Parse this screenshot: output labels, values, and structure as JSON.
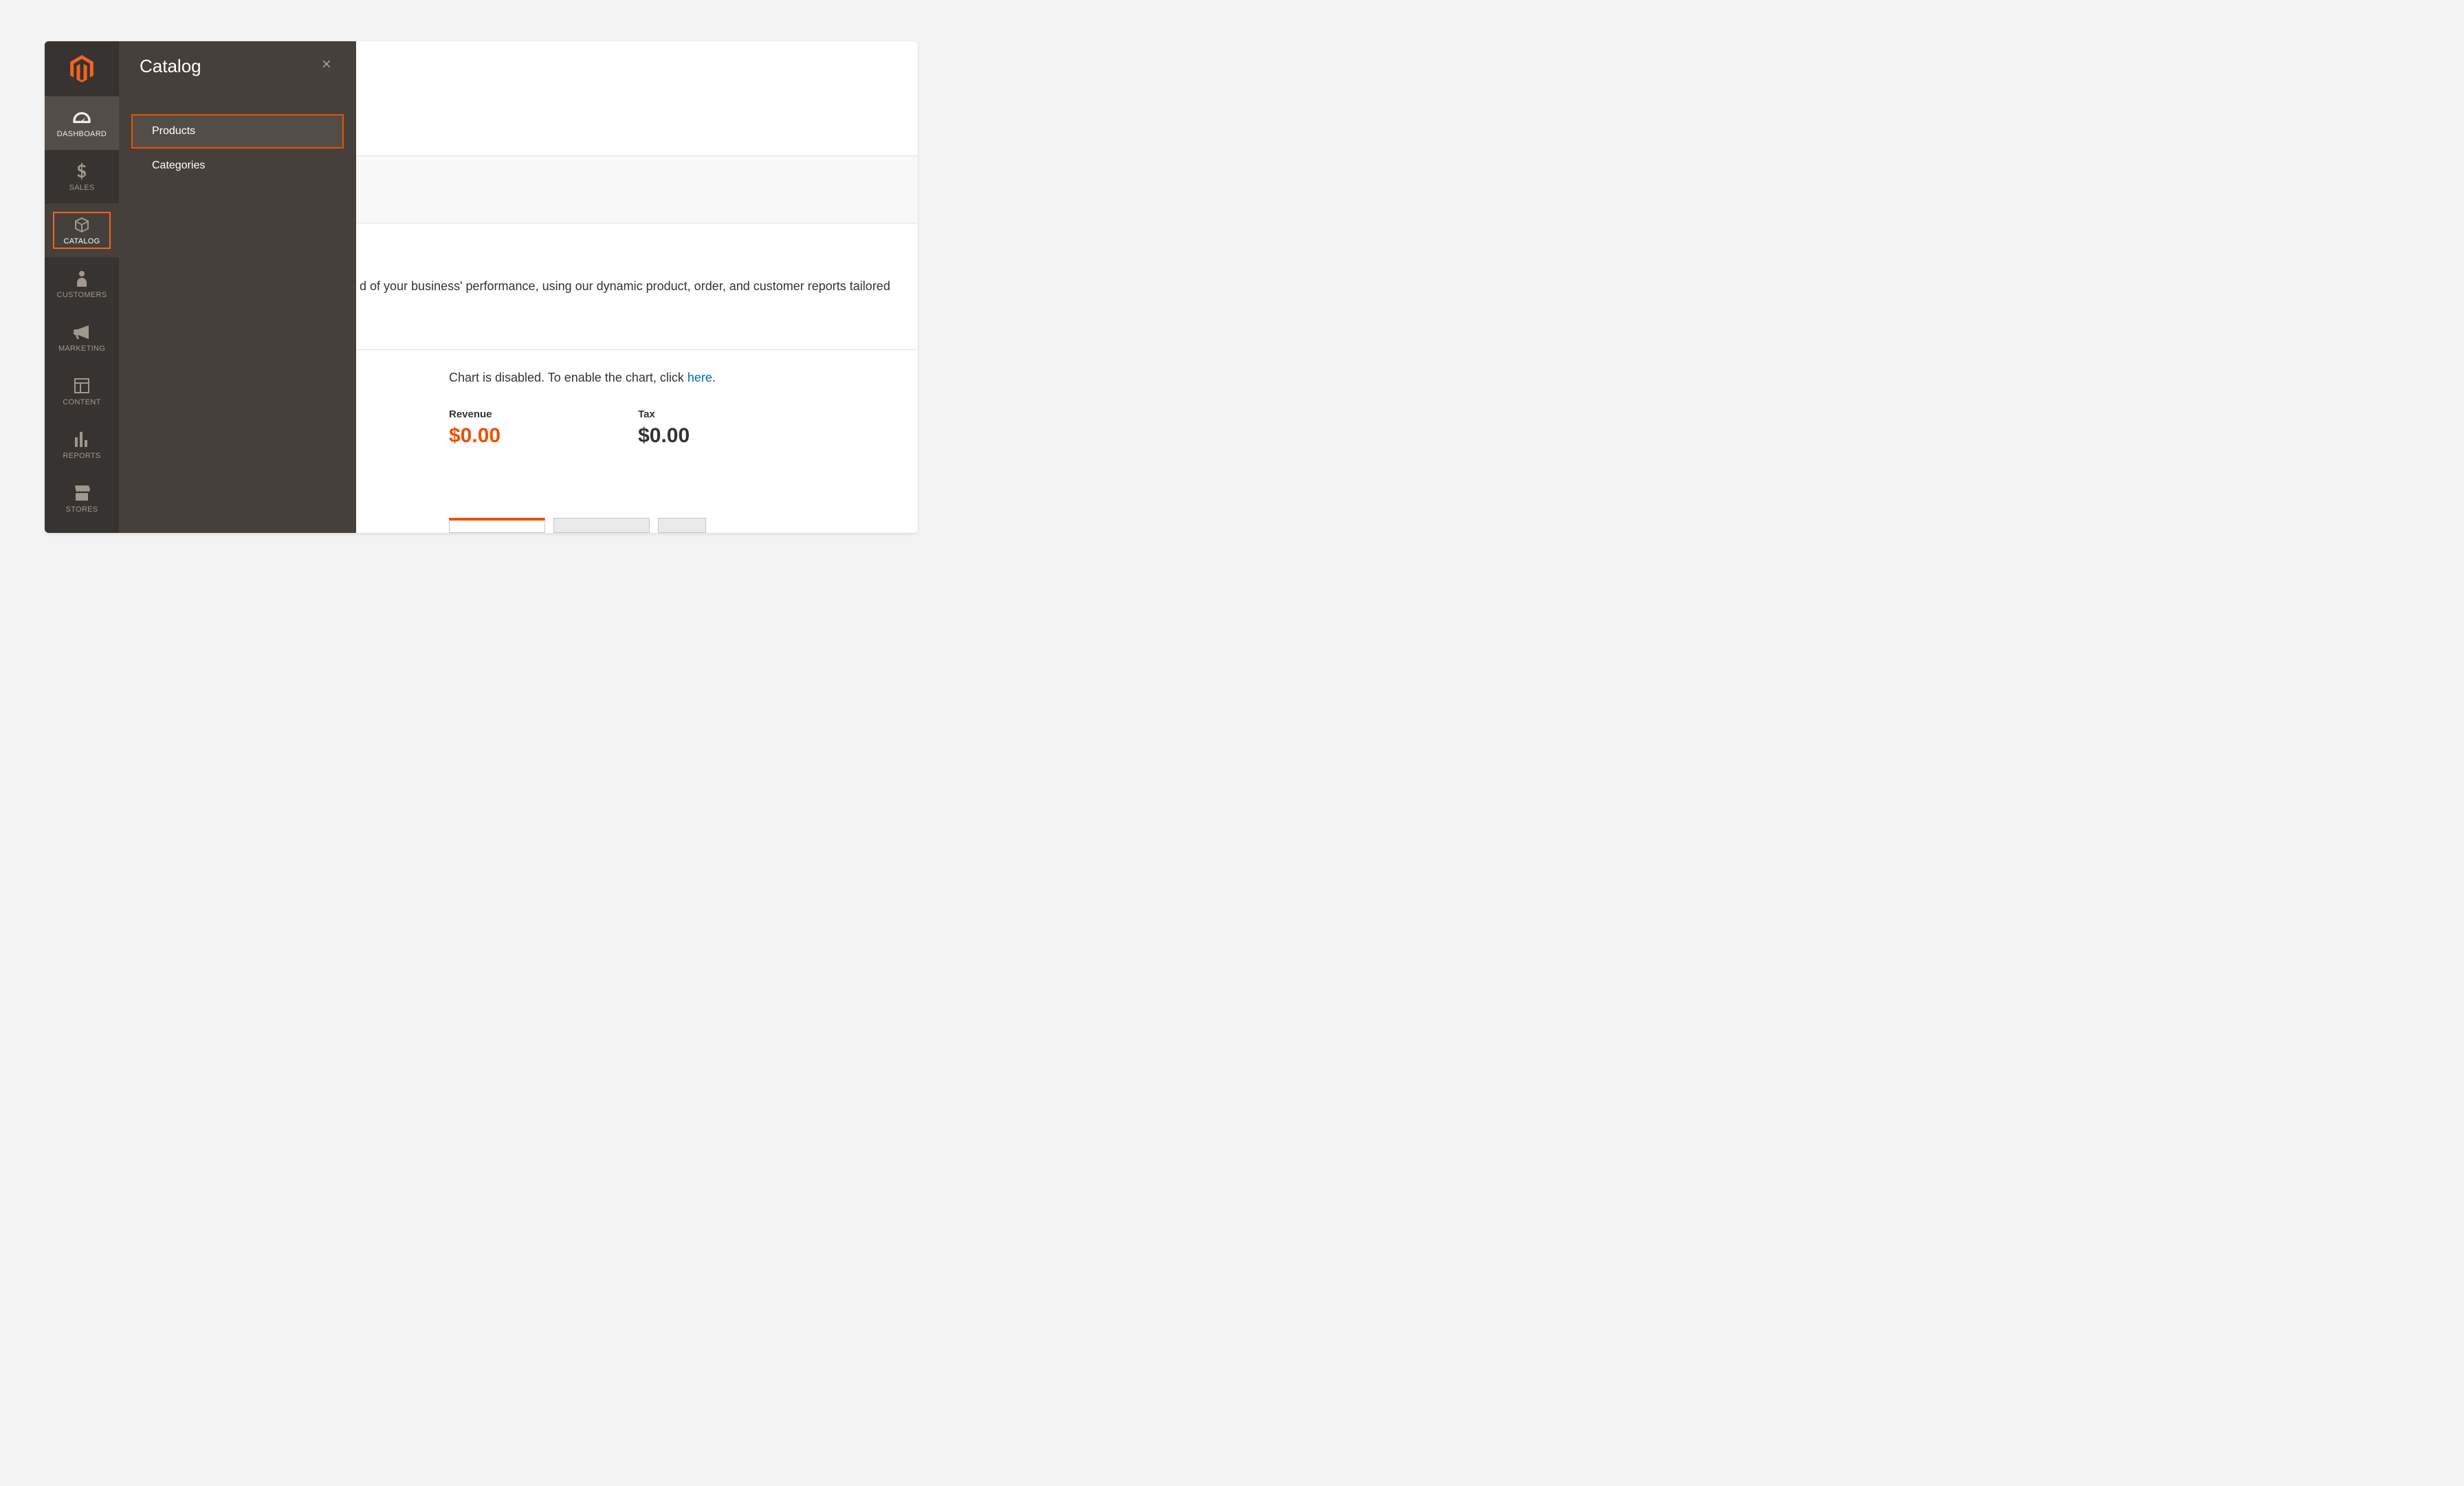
{
  "sidebar": {
    "items": [
      {
        "label": "Dashboard",
        "icon": "gauge-icon"
      },
      {
        "label": "Sales",
        "icon": "dollar-icon"
      },
      {
        "label": "Catalog",
        "icon": "box-icon"
      },
      {
        "label": "Customers",
        "icon": "person-icon"
      },
      {
        "label": "Marketing",
        "icon": "megaphone-icon"
      },
      {
        "label": "Content",
        "icon": "layout-icon"
      },
      {
        "label": "Reports",
        "icon": "bars-icon"
      },
      {
        "label": "Stores",
        "icon": "storefront-icon"
      }
    ]
  },
  "flyout": {
    "title": "Catalog",
    "items": [
      {
        "label": "Products"
      },
      {
        "label": "Categories"
      }
    ]
  },
  "main": {
    "promo_fragment": "d of your business' performance, using our dynamic product, order, and customer reports tailored",
    "chart_msg_prefix": "Chart is disabled. To enable the chart, click ",
    "chart_msg_link": "here",
    "chart_msg_suffix": ".",
    "metrics": [
      {
        "label": "Revenue",
        "value": "$0.00"
      },
      {
        "label": "Tax",
        "value": "$0.00"
      }
    ]
  }
}
